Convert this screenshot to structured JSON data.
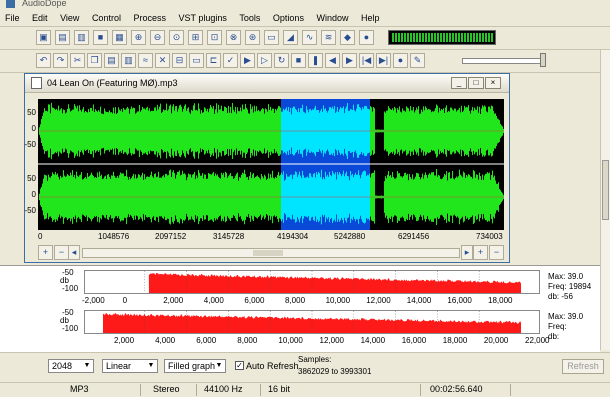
{
  "window": {
    "title": "AudioDope"
  },
  "menu": [
    "File",
    "Edit",
    "View",
    "Control",
    "Process",
    "VST plugins",
    "Tools",
    "Options",
    "Window",
    "Help"
  ],
  "toolbar1": {
    "icons": [
      "new-icon",
      "open-icon",
      "save-icon",
      "stop-record-icon",
      "save-as-icon",
      "zoom-in-icon",
      "zoom-out-icon",
      "zoom-selection-icon",
      "zoom-fit-icon",
      "zoom-vertical-icon",
      "zoom-back-icon",
      "zoom-all-icon",
      "screen-icon",
      "spectrum-icon",
      "waveform-icon",
      "eq-icon",
      "effect-icon",
      "info-icon"
    ]
  },
  "toolbar2": {
    "icons": [
      "undo-icon",
      "redo-icon",
      "cut-icon",
      "copy-icon",
      "paste-icon",
      "paste-new-icon",
      "mix-icon",
      "delete-icon",
      "crop-icon",
      "silence-icon",
      "trim-icon",
      "marker-icon",
      "play-icon",
      "play-selection-icon",
      "loop-icon",
      "stop-icon",
      "pause-icon",
      "rewind-icon",
      "forward-icon",
      "to-start-icon",
      "to-end-icon",
      "record-icon",
      "mic-icon"
    ]
  },
  "document": {
    "title": "04 Lean On (Featuring MØ).mp3",
    "y_labels_top": [
      "50",
      "0",
      "-50"
    ],
    "y_labels_bottom": [
      "50",
      "0",
      "-50"
    ],
    "x_labels": [
      "0",
      "1048576",
      "2097152",
      "3145728",
      "4194304",
      "5242880",
      "6291456",
      "734003"
    ]
  },
  "spectrum": {
    "row1": {
      "unit": "db",
      "ticks": [
        "-50",
        "-100"
      ],
      "x_labels": [
        "-2,000",
        "0",
        "2,000",
        "4,000",
        "6,000",
        "8,000",
        "10,000",
        "12,000",
        "14,000",
        "16,000",
        "18,000"
      ],
      "max": "Max: 39.0",
      "freq": "Freq: 19894",
      "db": "db: -56"
    },
    "row2": {
      "unit": "db",
      "ticks": [
        "-50",
        "-100"
      ],
      "x_labels": [
        "2,000",
        "4,000",
        "6,000",
        "8,000",
        "10,000",
        "12,000",
        "14,000",
        "16,000",
        "18,000",
        "20,000",
        "22,000"
      ],
      "max": "Max: 39.0",
      "freq": "Freq:",
      "db": "db:"
    }
  },
  "controls": {
    "fft_size": "2048",
    "scale": "Linear",
    "graph": "Filled graph",
    "auto_refresh": "Auto Refresh",
    "samples_label": "Samples:",
    "samples_range": "3862029 to 3993301",
    "refresh": "Refresh"
  },
  "status": {
    "format": "MP3",
    "channels": "Stereo",
    "rate": "44100 Hz",
    "bits": "16 bit",
    "time": "00:02:56.640"
  },
  "colors": {
    "wave": "#22e61c",
    "selection": "#00e5ff",
    "selection_bg": "#0a48d8",
    "spectrum": "#ff1a1a"
  }
}
